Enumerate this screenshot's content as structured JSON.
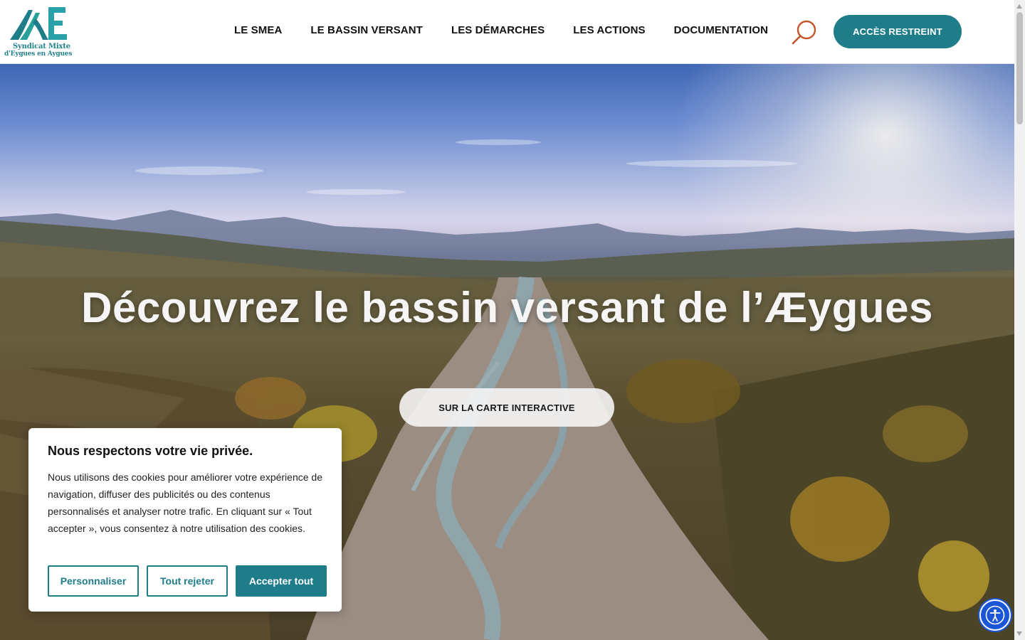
{
  "brand": {
    "logo_line1": "Syndicat Mixte",
    "logo_line2": "d'Eygues en Aygues",
    "color_primary": "#1f7d8a",
    "color_logo": "#23838f"
  },
  "nav": {
    "items": [
      {
        "label": "LE SMEA"
      },
      {
        "label": "LE BASSIN VERSANT"
      },
      {
        "label": "LES DÉMARCHES"
      },
      {
        "label": "LES ACTIONS"
      },
      {
        "label": "DOCUMENTATION"
      }
    ],
    "search_icon": "search-icon",
    "restricted_label": "ACCÈS RESTREINT"
  },
  "hero": {
    "title": "Découvrez le bassin versant de l’Æygues",
    "cta_label": "SUR LA CARTE INTERACTIVE"
  },
  "cookie_banner": {
    "title": "Nous respectons votre vie privée.",
    "body": "Nous utilisons des cookies pour améliorer votre expérience de navigation, diffuser des publicités ou des contenus personnalisés et analyser notre trafic. En cliquant sur « Tout accepter », vous consentez à notre utilisation des cookies.",
    "customize_label": "Personnaliser",
    "reject_label": "Tout rejeter",
    "accept_label": "Accepter tout"
  },
  "accessibility": {
    "icon": "accessibility-icon",
    "color": "#1a56d6"
  }
}
